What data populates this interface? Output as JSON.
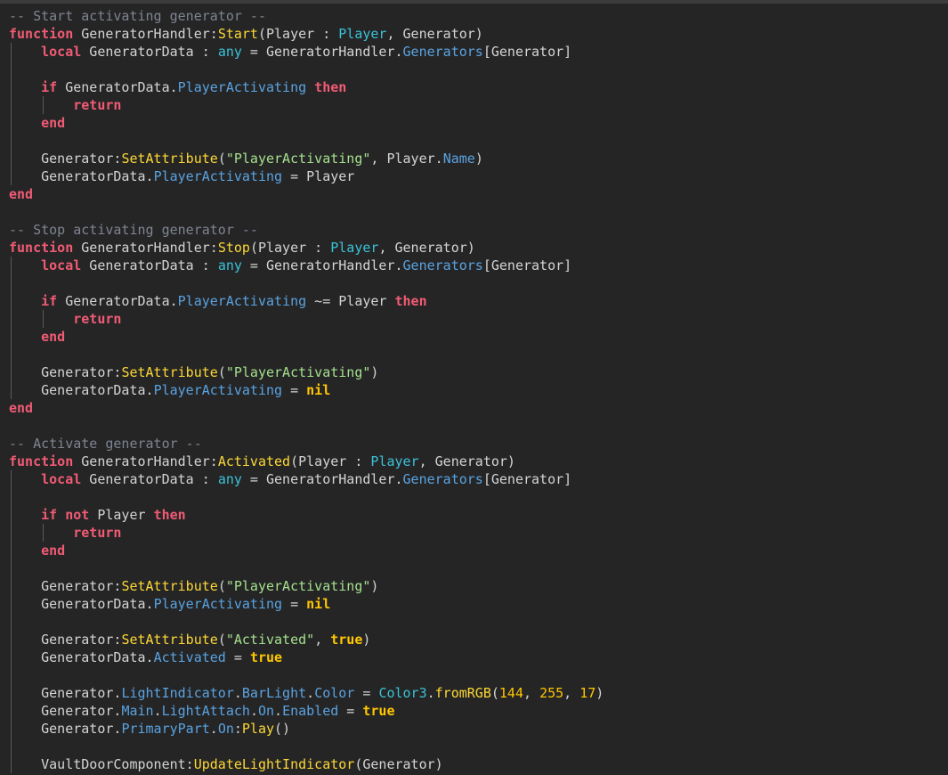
{
  "editor": {
    "language": "lua",
    "theme": {
      "background": "#252526",
      "comment": "#7f8490",
      "keyword": "#f15b74",
      "function": "#fdd835",
      "type": "#3ac2d6",
      "property": "#5aa3e0",
      "string": "#a5e08d",
      "boolean": "#ffc600",
      "number": "#ffc600",
      "plain": "#d4d4d4"
    },
    "lines": [
      {
        "indent": 0,
        "tokens": [
          [
            "comment",
            "-- Start activating generator --"
          ]
        ]
      },
      {
        "indent": 0,
        "tokens": [
          [
            "keyword",
            "function"
          ],
          [
            "plain",
            " GeneratorHandler:"
          ],
          [
            "fn",
            "Start"
          ],
          [
            "plain",
            "(Player : "
          ],
          [
            "type",
            "Player"
          ],
          [
            "plain",
            ", Generator)"
          ]
        ]
      },
      {
        "indent": 1,
        "tokens": [
          [
            "keyword",
            "local"
          ],
          [
            "plain",
            " GeneratorData : "
          ],
          [
            "type",
            "any"
          ],
          [
            "plain",
            " = GeneratorHandler."
          ],
          [
            "prop",
            "Generators"
          ],
          [
            "plain",
            "[Generator]"
          ]
        ]
      },
      {
        "indent": 1,
        "tokens": []
      },
      {
        "indent": 1,
        "tokens": [
          [
            "keyword",
            "if"
          ],
          [
            "plain",
            " GeneratorData."
          ],
          [
            "prop",
            "PlayerActivating"
          ],
          [
            "plain",
            " "
          ],
          [
            "keyword",
            "then"
          ]
        ]
      },
      {
        "indent": 2,
        "tokens": [
          [
            "keyword",
            "return"
          ]
        ]
      },
      {
        "indent": 1,
        "tokens": [
          [
            "keyword",
            "end"
          ]
        ]
      },
      {
        "indent": 1,
        "tokens": []
      },
      {
        "indent": 1,
        "tokens": [
          [
            "plain",
            "Generator:"
          ],
          [
            "fn",
            "SetAttribute"
          ],
          [
            "plain",
            "("
          ],
          [
            "string",
            "\"PlayerActivating\""
          ],
          [
            "plain",
            ", Player."
          ],
          [
            "prop",
            "Name"
          ],
          [
            "plain",
            ")"
          ]
        ]
      },
      {
        "indent": 1,
        "tokens": [
          [
            "plain",
            "GeneratorData."
          ],
          [
            "prop",
            "PlayerActivating"
          ],
          [
            "plain",
            " = Player"
          ]
        ]
      },
      {
        "indent": 0,
        "tokens": [
          [
            "keyword",
            "end"
          ]
        ]
      },
      {
        "indent": 0,
        "tokens": []
      },
      {
        "indent": 0,
        "tokens": [
          [
            "comment",
            "-- Stop activating generator --"
          ]
        ]
      },
      {
        "indent": 0,
        "tokens": [
          [
            "keyword",
            "function"
          ],
          [
            "plain",
            " GeneratorHandler:"
          ],
          [
            "fn",
            "Stop"
          ],
          [
            "plain",
            "(Player : "
          ],
          [
            "type",
            "Player"
          ],
          [
            "plain",
            ", Generator)"
          ]
        ]
      },
      {
        "indent": 1,
        "tokens": [
          [
            "keyword",
            "local"
          ],
          [
            "plain",
            " GeneratorData : "
          ],
          [
            "type",
            "any"
          ],
          [
            "plain",
            " = GeneratorHandler."
          ],
          [
            "prop",
            "Generators"
          ],
          [
            "plain",
            "[Generator]"
          ]
        ]
      },
      {
        "indent": 1,
        "tokens": []
      },
      {
        "indent": 1,
        "tokens": [
          [
            "keyword",
            "if"
          ],
          [
            "plain",
            " GeneratorData."
          ],
          [
            "prop",
            "PlayerActivating"
          ],
          [
            "plain",
            " ~= Player "
          ],
          [
            "keyword",
            "then"
          ]
        ]
      },
      {
        "indent": 2,
        "tokens": [
          [
            "keyword",
            "return"
          ]
        ]
      },
      {
        "indent": 1,
        "tokens": [
          [
            "keyword",
            "end"
          ]
        ]
      },
      {
        "indent": 1,
        "tokens": []
      },
      {
        "indent": 1,
        "tokens": [
          [
            "plain",
            "Generator:"
          ],
          [
            "fn",
            "SetAttribute"
          ],
          [
            "plain",
            "("
          ],
          [
            "string",
            "\"PlayerActivating\""
          ],
          [
            "plain",
            ")"
          ]
        ]
      },
      {
        "indent": 1,
        "tokens": [
          [
            "plain",
            "GeneratorData."
          ],
          [
            "prop",
            "PlayerActivating"
          ],
          [
            "plain",
            " = "
          ],
          [
            "bool",
            "nil"
          ]
        ]
      },
      {
        "indent": 0,
        "tokens": [
          [
            "keyword",
            "end"
          ]
        ]
      },
      {
        "indent": 0,
        "tokens": []
      },
      {
        "indent": 0,
        "tokens": [
          [
            "comment",
            "-- Activate generator --"
          ]
        ]
      },
      {
        "indent": 0,
        "tokens": [
          [
            "keyword",
            "function"
          ],
          [
            "plain",
            " GeneratorHandler:"
          ],
          [
            "fn",
            "Activated"
          ],
          [
            "plain",
            "(Player : "
          ],
          [
            "type",
            "Player"
          ],
          [
            "plain",
            ", Generator)"
          ]
        ]
      },
      {
        "indent": 1,
        "tokens": [
          [
            "keyword",
            "local"
          ],
          [
            "plain",
            " GeneratorData : "
          ],
          [
            "type",
            "any"
          ],
          [
            "plain",
            " = GeneratorHandler."
          ],
          [
            "prop",
            "Generators"
          ],
          [
            "plain",
            "[Generator]"
          ]
        ]
      },
      {
        "indent": 1,
        "tokens": []
      },
      {
        "indent": 1,
        "tokens": [
          [
            "keyword",
            "if"
          ],
          [
            "plain",
            " "
          ],
          [
            "keyword",
            "not"
          ],
          [
            "plain",
            " Player "
          ],
          [
            "keyword",
            "then"
          ]
        ]
      },
      {
        "indent": 2,
        "tokens": [
          [
            "keyword",
            "return"
          ]
        ]
      },
      {
        "indent": 1,
        "tokens": [
          [
            "keyword",
            "end"
          ]
        ]
      },
      {
        "indent": 1,
        "tokens": []
      },
      {
        "indent": 1,
        "tokens": [
          [
            "plain",
            "Generator:"
          ],
          [
            "fn",
            "SetAttribute"
          ],
          [
            "plain",
            "("
          ],
          [
            "string",
            "\"PlayerActivating\""
          ],
          [
            "plain",
            ")"
          ]
        ]
      },
      {
        "indent": 1,
        "tokens": [
          [
            "plain",
            "GeneratorData."
          ],
          [
            "prop",
            "PlayerActivating"
          ],
          [
            "plain",
            " = "
          ],
          [
            "bool",
            "nil"
          ]
        ]
      },
      {
        "indent": 1,
        "tokens": []
      },
      {
        "indent": 1,
        "tokens": [
          [
            "plain",
            "Generator:"
          ],
          [
            "fn",
            "SetAttribute"
          ],
          [
            "plain",
            "("
          ],
          [
            "string",
            "\"Activated\""
          ],
          [
            "plain",
            ", "
          ],
          [
            "bool",
            "true"
          ],
          [
            "plain",
            ")"
          ]
        ]
      },
      {
        "indent": 1,
        "tokens": [
          [
            "plain",
            "GeneratorData."
          ],
          [
            "prop",
            "Activated"
          ],
          [
            "plain",
            " = "
          ],
          [
            "bool",
            "true"
          ]
        ]
      },
      {
        "indent": 1,
        "tokens": []
      },
      {
        "indent": 1,
        "tokens": [
          [
            "plain",
            "Generator."
          ],
          [
            "prop",
            "LightIndicator"
          ],
          [
            "plain",
            "."
          ],
          [
            "prop",
            "BarLight"
          ],
          [
            "plain",
            "."
          ],
          [
            "prop",
            "Color"
          ],
          [
            "plain",
            " = "
          ],
          [
            "type",
            "Color3"
          ],
          [
            "plain",
            "."
          ],
          [
            "fn",
            "fromRGB"
          ],
          [
            "plain",
            "("
          ],
          [
            "num",
            "144"
          ],
          [
            "plain",
            ", "
          ],
          [
            "num",
            "255"
          ],
          [
            "plain",
            ", "
          ],
          [
            "num",
            "17"
          ],
          [
            "plain",
            ")"
          ]
        ]
      },
      {
        "indent": 1,
        "tokens": [
          [
            "plain",
            "Generator."
          ],
          [
            "prop",
            "Main"
          ],
          [
            "plain",
            "."
          ],
          [
            "prop",
            "LightAttach"
          ],
          [
            "plain",
            "."
          ],
          [
            "prop",
            "On"
          ],
          [
            "plain",
            "."
          ],
          [
            "prop",
            "Enabled"
          ],
          [
            "plain",
            " = "
          ],
          [
            "bool",
            "true"
          ]
        ]
      },
      {
        "indent": 1,
        "tokens": [
          [
            "plain",
            "Generator."
          ],
          [
            "prop",
            "PrimaryPart"
          ],
          [
            "plain",
            "."
          ],
          [
            "prop",
            "On"
          ],
          [
            "plain",
            ":"
          ],
          [
            "fn",
            "Play"
          ],
          [
            "plain",
            "()"
          ]
        ]
      },
      {
        "indent": 1,
        "tokens": []
      },
      {
        "indent": 1,
        "tokens": [
          [
            "plain",
            "VaultDoorComponent:"
          ],
          [
            "fn",
            "UpdateLightIndicator"
          ],
          [
            "plain",
            "(Generator)"
          ]
        ]
      }
    ]
  }
}
